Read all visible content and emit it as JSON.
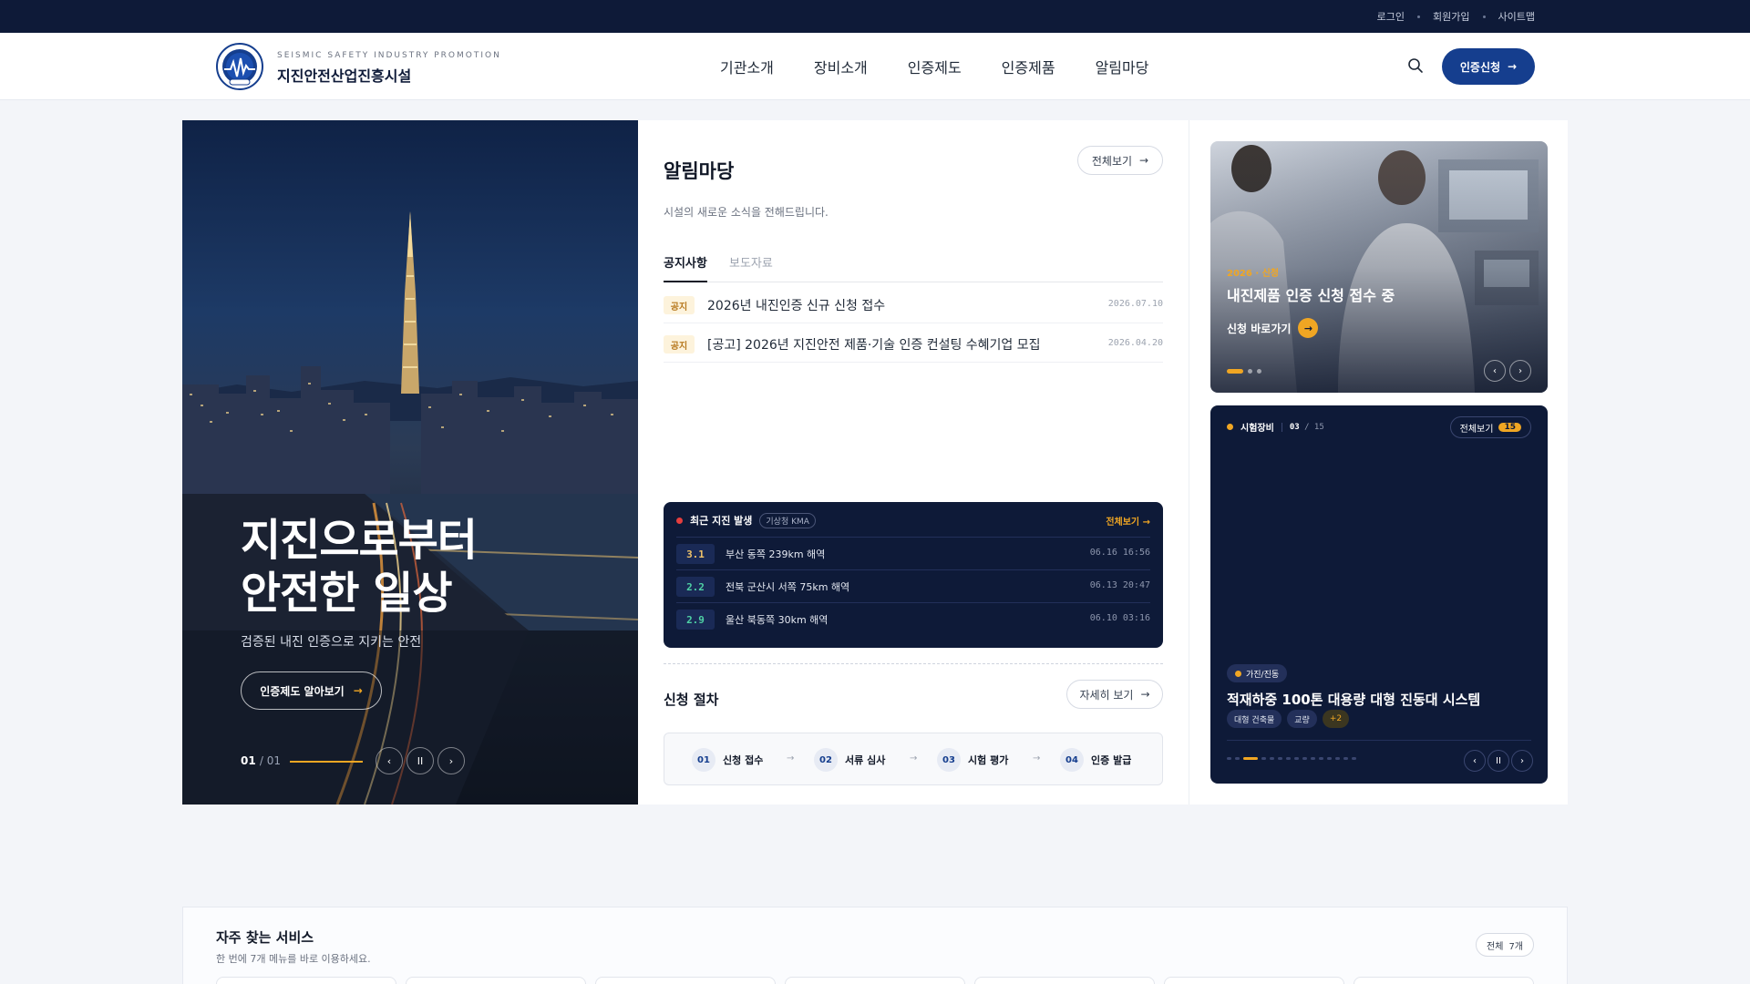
{
  "topbar": {
    "links": [
      "로그인",
      "회원가입",
      "사이트맵"
    ]
  },
  "header": {
    "brand_en": "SEISMIC SAFETY INDUSTRY PROMOTION",
    "brand_ko": "지진안전산업진흥시설",
    "nav": [
      "기관소개",
      "장비소개",
      "인증제도",
      "인증제품",
      "알림마당"
    ],
    "apply_label": "인증신청"
  },
  "hero": {
    "title_line1": "지진으로부터",
    "title_line2": "안전한 일상",
    "subtitle": "검증된 내진 인증으로 지키는 안전",
    "button_label": "인증제도 알아보기",
    "current": "01",
    "total": "01"
  },
  "notices": {
    "title": "알림마당",
    "description": "시설의 새로운 소식을 전해드립니다.",
    "view_all": "전체보기",
    "tabs": [
      "공지사항",
      "보도자료"
    ],
    "items": [
      {
        "tag": "공지",
        "text": "2026년 내진인증 신규 신청 접수",
        "date": "2026.07.10"
      },
      {
        "tag": "공지",
        "text": "[공고] 2026년 지진안전 제품·기술 인증 컨설팅 수혜기업 모집",
        "date": "2026.04.20"
      }
    ]
  },
  "earthquakes": {
    "title": "최근 지진 발생",
    "source": "기상청 KMA",
    "view_all": "전체보기",
    "items": [
      {
        "mag": "3.1",
        "location": "부산 동쪽 239km 해역",
        "time": "06.16 16:56",
        "color": "#f0c36a"
      },
      {
        "mag": "2.2",
        "location": "전북 군산시 서쪽 75km 해역",
        "time": "06.13 20:47",
        "color": "#4fd1a5"
      },
      {
        "mag": "2.9",
        "location": "울산 북동쪽 30km 해역",
        "time": "06.10 03:16",
        "color": "#4fd1a5"
      }
    ]
  },
  "process": {
    "title": "신청 절차",
    "view_more": "자세히 보기",
    "steps": [
      {
        "num": "01",
        "label": "신청 접수"
      },
      {
        "num": "02",
        "label": "서류 심사"
      },
      {
        "num": "03",
        "label": "시험 평가"
      },
      {
        "num": "04",
        "label": "인증 발급"
      }
    ]
  },
  "banner": {
    "tag": "2026 · 신청",
    "title": "내진제품 인증 신청 접수 중",
    "link": "신청 바로가기"
  },
  "equipment": {
    "section": "시험장비",
    "current": "03",
    "total": "15",
    "view_all": "전체보기",
    "count": "15",
    "category": "가진/진동",
    "title": "적재하중 100톤 대용량 대형 진동대 시스템",
    "chips": [
      "대형 건축물",
      "교량",
      "+2"
    ]
  },
  "services": {
    "title": "자주 찾는 서비스",
    "description": "한 번에 7개 메뉴를 바로 이용하세요.",
    "all_label": "전체",
    "all_count": "7개"
  },
  "colors": {
    "navy": "#0e1a38",
    "accent": "#f0a623",
    "primary": "#153e8e"
  }
}
